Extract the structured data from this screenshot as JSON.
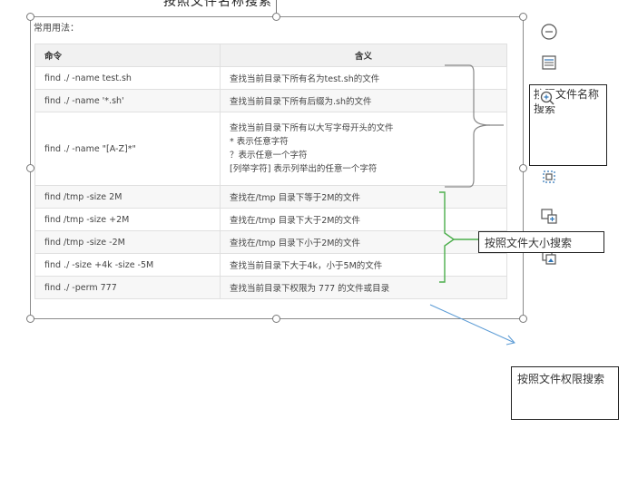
{
  "top_text": "按照文件名称搜索",
  "caption": "常用用法：",
  "table": {
    "headers": [
      "命令",
      "含义"
    ],
    "rows": [
      {
        "cmd": "find ./ -name test.sh",
        "desc": [
          "查找当前目录下所有名为test.sh的文件"
        ]
      },
      {
        "cmd": "find ./ -name '*.sh'",
        "desc": [
          "查找当前目录下所有后缀为.sh的文件"
        ]
      },
      {
        "cmd": "find ./ -name \"[A-Z]*\"",
        "desc": [
          "查找当前目录下所有以大写字母开头的文件",
          "* 表示任意字符",
          "？表示任意一个字符",
          "[列举字符] 表示列举出的任意一个字符"
        ]
      },
      {
        "cmd": "find /tmp -size 2M",
        "desc": [
          "查找在/tmp 目录下等于2M的文件"
        ]
      },
      {
        "cmd": "find /tmp -size +2M",
        "desc": [
          "查找在/tmp 目录下大于2M的文件"
        ]
      },
      {
        "cmd": "find /tmp -size -2M",
        "desc": [
          "查找在/tmp 目录下小于2M的文件"
        ]
      },
      {
        "cmd": "find ./ -size +4k -size -5M",
        "desc": [
          "查找当前目录下大于4k，小于5M的文件"
        ]
      },
      {
        "cmd": "find ./ -perm 777",
        "desc": [
          "查找当前目录下权限为 777 的文件或目录"
        ]
      }
    ]
  },
  "annotations": {
    "name_search": "按照文件名称搜索",
    "size_search": "按照文件大小搜索",
    "perm_search": "按照文件权限搜索"
  },
  "toolbar": {
    "items": [
      "collapse-icon",
      "layout-icon",
      "zoom-in-icon",
      "crop-icon",
      "screenshot-icon",
      "add-image-icon",
      "replace-image-icon"
    ]
  },
  "colors": {
    "name_bracket": "#888888",
    "size_bracket": "#4cae4c",
    "arrow": "#5b9bd5"
  }
}
